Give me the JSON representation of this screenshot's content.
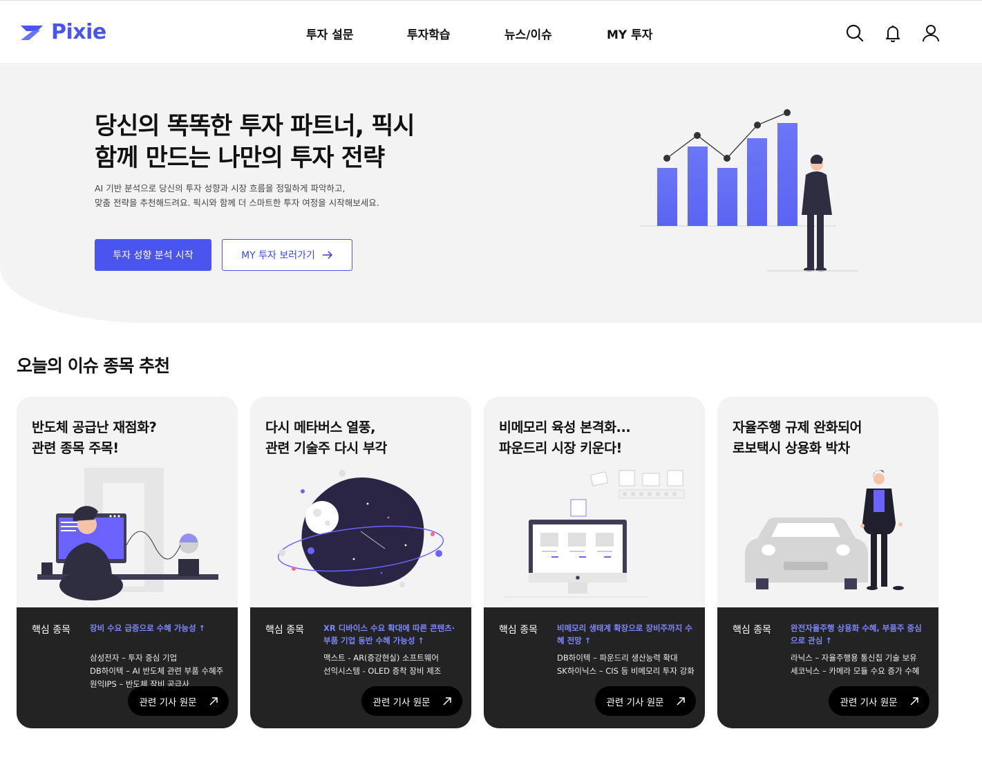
{
  "brand": {
    "name": "Pixie",
    "accent": "#4a55f0"
  },
  "nav": {
    "items": [
      "투자 설문",
      "투자학습",
      "뉴스/이슈",
      "MY 투자"
    ]
  },
  "header_icons": [
    "search-icon",
    "bell-icon",
    "user-icon"
  ],
  "hero": {
    "title_line1": "당신의 똑똑한 투자 파트너, 픽시",
    "title_line2": "함께 만드는 나만의 투자 전략",
    "desc_line1": "AI 기반 분석으로 당신의 투자 성향과 시장 흐름을 정밀하게 파악하고,",
    "desc_line2": "맞춤 전략을 추천해드려요. 픽시와 함께 더 스마트한 투자 여정을 시작해보세요.",
    "primary_button": "투자 성향 분석 시작",
    "secondary_button": "MY 투자 보러가기"
  },
  "section_title": "오늘의 이슈 종목 추천",
  "cards": [
    {
      "title_line1": "반도체 공급난 재점화?",
      "title_line2": "관련 종목 주목!",
      "core_label": "핵심 종목",
      "headline": "장비 수요 급증으로 수혜 가능성 ↑",
      "items": [
        "삼성전자 – 투자 중심 기업",
        "DB하이텍 – AI 반도체 관련 부품 수혜주",
        "원익IPS – 반도체 장비 공급사"
      ],
      "button": "관련 기사 원문"
    },
    {
      "title_line1": "다시 메타버스 열풍,",
      "title_line2": "관련 기술주 다시 부각",
      "core_label": "핵심 종목",
      "headline": "XR 디바이스 수요 확대에 따른 콘텐츠·부품 기업 동반 수혜 가능성 ↑",
      "items": [
        "맥스트 - AR(증강현실) 소프트웨어",
        "선익시스템 - OLED 증착 장비 제조"
      ],
      "button": "관련 기사 원문"
    },
    {
      "title_line1": "비메모리 육성 본격화...",
      "title_line2": "파운드리 시장 키운다!",
      "core_label": "핵심 종목",
      "headline": "비메모리 생태계 확장으로 장비주까지 수혜 전망 ↑",
      "items": [
        "DB하이텍 – 파운드리 생산능력 확대",
        "SK하이닉스 – CIS 등 비메모리 투자 강화"
      ],
      "button": "관련 기사 원문"
    },
    {
      "title_line1": "자율주행 규제 완화되어",
      "title_line2": "로보택시 상용화 박차",
      "core_label": "핵심 종목",
      "headline": "완전자율주행 상용화 수혜, 부품주 중심으로 관심 ↑",
      "items": [
        "라닉스 – 자율주행용 통신칩 기술 보유",
        "세코닉스 – 카메라 모듈 수요 증가 수혜"
      ],
      "button": "관련 기사 원문"
    }
  ]
}
